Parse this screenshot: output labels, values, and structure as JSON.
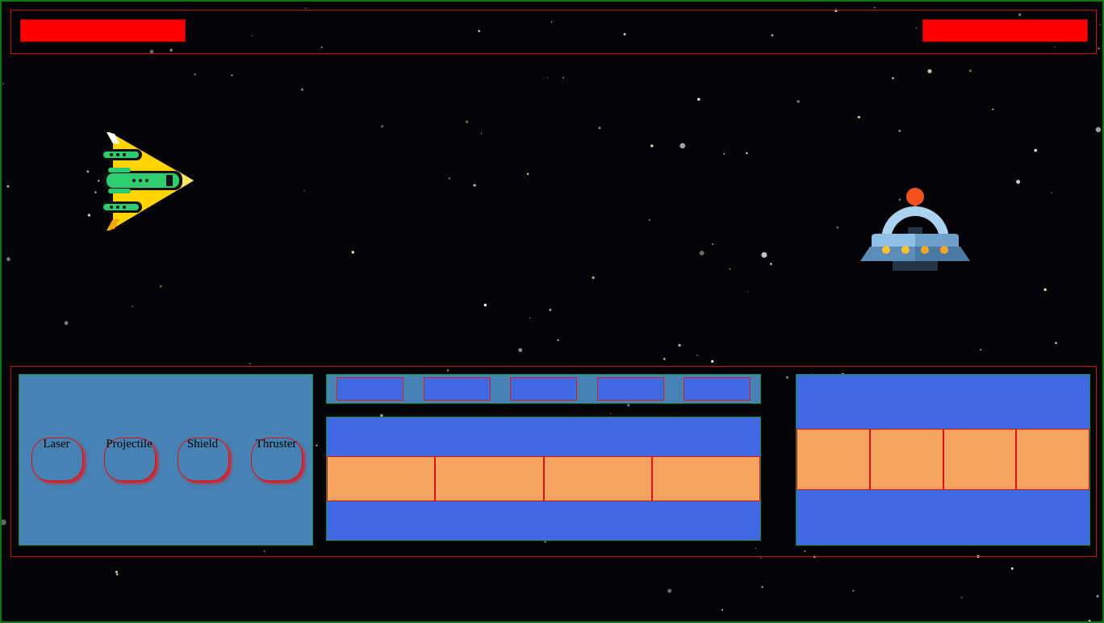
{
  "colors": {
    "background": "#040406",
    "frame_border": "#0a7a0a",
    "hud_border": "#d01010",
    "health_fill": "#ff0000",
    "panel_steelblue": "#4682b4",
    "panel_royalblue": "#4169e1",
    "cell_sandybrown": "#f4a460"
  },
  "hud": {
    "player_health": 1.0,
    "enemy_health": 1.0
  },
  "ships": {
    "player": {
      "icon": "player-spaceship-icon",
      "colors": [
        "#ffd400",
        "#2ecc71",
        "#111111"
      ]
    },
    "enemy": {
      "icon": "ufo-icon",
      "colors": [
        "#8fc1e6",
        "#5b8db8",
        "#f4511e",
        "#fbc02d"
      ]
    }
  },
  "abilities": [
    {
      "label": "Laser"
    },
    {
      "label": "Projectile"
    },
    {
      "label": "Shield"
    },
    {
      "label": "Thruster"
    }
  ],
  "slots": [
    {
      "id": 1
    },
    {
      "id": 2
    },
    {
      "id": 3
    },
    {
      "id": 4
    },
    {
      "id": 5
    }
  ],
  "grid_a": {
    "cells": 4
  },
  "grid_b": {
    "cells": 4
  }
}
